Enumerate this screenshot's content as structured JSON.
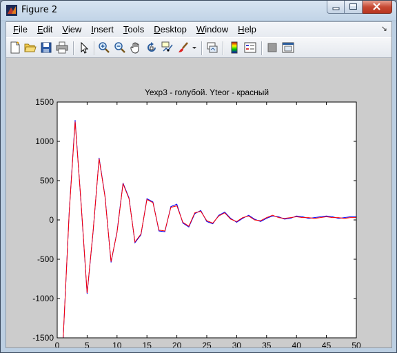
{
  "window": {
    "title": "Figure 2",
    "icon": "matlab-icon"
  },
  "menu": {
    "items": [
      {
        "label": "File",
        "accel": "F",
        "rest": "ile"
      },
      {
        "label": "Edit",
        "accel": "E",
        "rest": "dit"
      },
      {
        "label": "View",
        "accel": "V",
        "rest": "iew"
      },
      {
        "label": "Insert",
        "accel": "I",
        "rest": "nsert"
      },
      {
        "label": "Tools",
        "accel": "T",
        "rest": "ools"
      },
      {
        "label": "Desktop",
        "accel": "D",
        "rest": "esktop"
      },
      {
        "label": "Window",
        "accel": "W",
        "rest": "indow"
      },
      {
        "label": "Help",
        "accel": "H",
        "rest": "elp"
      }
    ]
  },
  "toolbar": {
    "buttons": [
      "new-figure-icon",
      "open-file-icon",
      "save-icon",
      "print-icon",
      "edit-plot-arrow-icon",
      "zoom-in-icon",
      "zoom-out-icon",
      "pan-hand-icon",
      "rotate-3d-icon",
      "data-cursor-icon",
      "brush-icon",
      "brush-dropdown-icon",
      "link-plot-icon",
      "colorbar-icon",
      "legend-icon",
      "hide-plot-tools-icon",
      "show-plot-tools-icon"
    ]
  },
  "chart_data": {
    "type": "line",
    "title": "Yexp3 - голубой. Yteor - красный",
    "xlabel": "",
    "ylabel": "",
    "xlim": [
      0,
      50
    ],
    "ylim": [
      -1500,
      1500
    ],
    "xticks": [
      0,
      5,
      10,
      15,
      20,
      25,
      30,
      35,
      40,
      45,
      50
    ],
    "yticks": [
      1500,
      1000,
      500,
      0,
      -500,
      -1000,
      -1500
    ],
    "grid": false,
    "colors": {
      "blue": "#0000ff",
      "red": "#ff0000"
    },
    "series": [
      {
        "color": "blue",
        "x": [
          1,
          2,
          3,
          4,
          5,
          6,
          7,
          8,
          9,
          10,
          11,
          12,
          13,
          14,
          15,
          16,
          17,
          18,
          19,
          20,
          21,
          22,
          23,
          24,
          25,
          26,
          27,
          28,
          29,
          30,
          31,
          32,
          33,
          34,
          35,
          36,
          37,
          38,
          39,
          40,
          41,
          42,
          43,
          44,
          45,
          46,
          47,
          48,
          49,
          50
        ],
        "y": [
          -1500,
          100,
          1270,
          200,
          -940,
          -150,
          790,
          300,
          -540,
          -150,
          470,
          280,
          -290,
          -190,
          270,
          230,
          -140,
          -150,
          170,
          200,
          -40,
          -90,
          80,
          120,
          -20,
          -50,
          60,
          100,
          20,
          -30,
          20,
          60,
          10,
          -20,
          20,
          50,
          40,
          10,
          20,
          50,
          40,
          20,
          30,
          40,
          50,
          40,
          20,
          30,
          40,
          40
        ]
      },
      {
        "color": "red",
        "x": [
          1,
          2,
          3,
          4,
          5,
          6,
          7,
          8,
          9,
          10,
          11,
          12,
          13,
          14,
          15,
          16,
          17,
          18,
          19,
          20,
          21,
          22,
          23,
          24,
          25,
          26,
          27,
          28,
          29,
          30,
          31,
          32,
          33,
          34,
          35,
          36,
          37,
          38,
          39,
          40,
          41,
          42,
          43,
          44,
          45,
          46,
          47,
          48,
          49,
          50
        ],
        "y": [
          -1500,
          90,
          1250,
          210,
          -930,
          -140,
          780,
          290,
          -530,
          -160,
          460,
          270,
          -280,
          -180,
          260,
          220,
          -130,
          -140,
          160,
          180,
          -30,
          -80,
          90,
          110,
          -10,
          -40,
          50,
          90,
          10,
          -20,
          30,
          50,
          0,
          -10,
          30,
          60,
          30,
          20,
          30,
          40,
          30,
          30,
          20,
          30,
          40,
          30,
          30,
          20,
          30,
          30
        ]
      }
    ]
  }
}
